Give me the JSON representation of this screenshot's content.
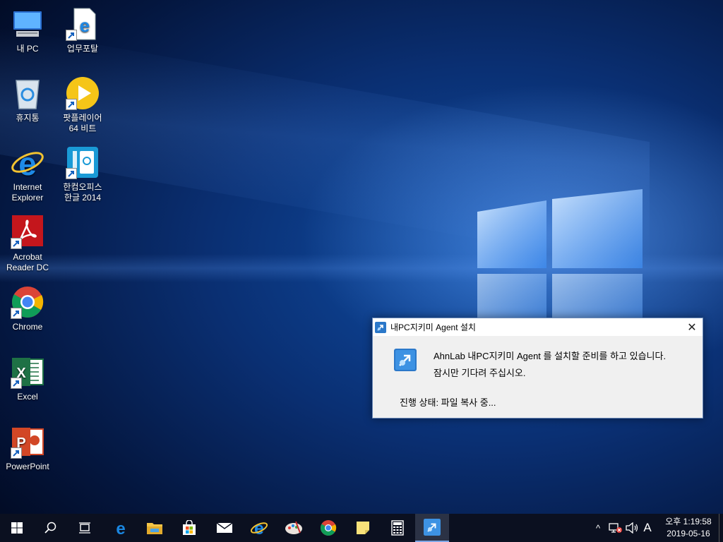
{
  "desktop": {
    "icons": [
      {
        "label": "내 PC"
      },
      {
        "label": "업무포탈"
      },
      {
        "label": "휴지통"
      },
      {
        "label_line1": "팟플레이어",
        "label_line2": "64 비트"
      },
      {
        "label_line1": "Internet",
        "label_line2": "Explorer"
      },
      {
        "label_line1": "한컴오피스",
        "label_line2": "한글 2014"
      },
      {
        "label_line1": "Acrobat",
        "label_line2": "Reader DC"
      },
      {
        "label": "Chrome"
      },
      {
        "label": "Excel"
      },
      {
        "label": "PowerPoint"
      }
    ]
  },
  "dialog": {
    "title": "내PC지키미 Agent 설치",
    "close_glyph": "✕",
    "message_line1": "AhnLab 내PC지키미 Agent 를 설치할 준비를 하고 있습니다.",
    "message_line2": "잠시만 기다려 주십시오.",
    "status": "진행 상태: 파일 복사 중..."
  },
  "taskbar": {
    "input_indicator": "A",
    "clock_time": "오후 1:19:58",
    "clock_date": "2019-05-16",
    "tray_chevron": "^"
  }
}
